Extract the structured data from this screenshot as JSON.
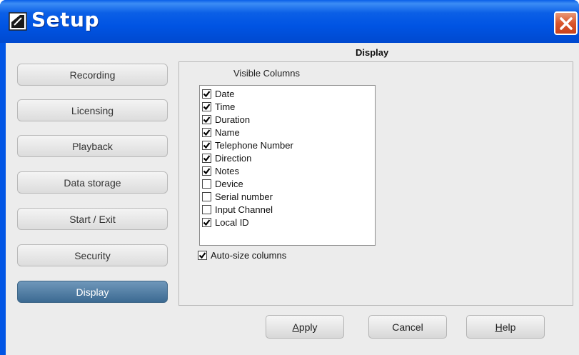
{
  "window": {
    "title": "Setup"
  },
  "nav": {
    "items": [
      {
        "label": "Recording",
        "active": false
      },
      {
        "label": "Licensing",
        "active": false
      },
      {
        "label": "Playback",
        "active": false
      },
      {
        "label": "Data storage",
        "active": false
      },
      {
        "label": "Start / Exit",
        "active": false
      },
      {
        "label": "Security",
        "active": false
      },
      {
        "label": "Display",
        "active": true
      }
    ]
  },
  "display": {
    "section_title": "Display",
    "visible_columns_label": "Visible Columns",
    "columns": [
      {
        "label": "Date",
        "checked": true
      },
      {
        "label": "Time",
        "checked": true
      },
      {
        "label": "Duration",
        "checked": true
      },
      {
        "label": "Name",
        "checked": true
      },
      {
        "label": "Telephone Number",
        "checked": true
      },
      {
        "label": "Direction",
        "checked": true
      },
      {
        "label": "Notes",
        "checked": true
      },
      {
        "label": "Device",
        "checked": false
      },
      {
        "label": "Serial number",
        "checked": false
      },
      {
        "label": "Input Channel",
        "checked": false
      },
      {
        "label": "Local ID",
        "checked": true
      }
    ],
    "auto_size": {
      "label": "Auto-size columns",
      "checked": true
    }
  },
  "buttons": {
    "apply_mnemonic": "A",
    "apply_rest": "pply",
    "cancel": "Cancel",
    "help_mnemonic": "H",
    "help_rest": "elp"
  },
  "colors": {
    "titlebar": "#0054e3",
    "close_button": "#d9552c",
    "active_nav": "#4a7aa3",
    "dialog_bg": "#ececec"
  }
}
